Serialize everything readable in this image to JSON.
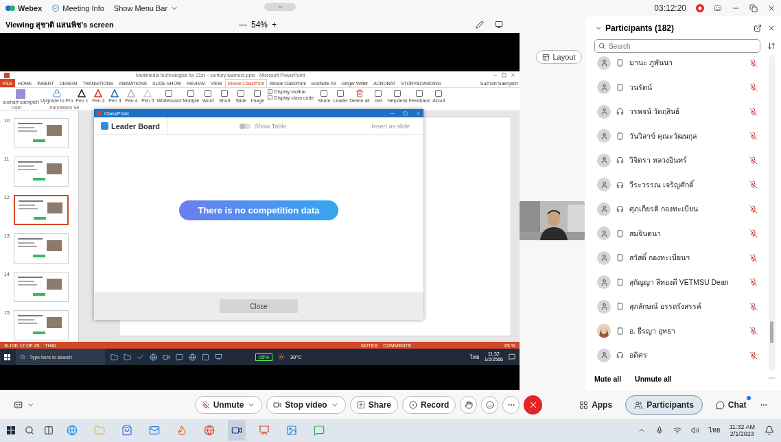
{
  "app_bar": {
    "brand": "Webex",
    "menus": [
      {
        "label": "Meeting Info",
        "kind": "info"
      },
      {
        "label": "Show Menu Bar",
        "kind": "dropdown"
      }
    ],
    "timer": "03:12:20"
  },
  "stage": {
    "viewing": "Viewing สุชาติ แสนพิช's screen",
    "zoom_minus": "—",
    "zoom": "54%",
    "zoom_plus": "+",
    "layout_button": "Layout"
  },
  "shared_screen": {
    "title": "Multimedia technologies for 21st ~ century learners.pptx - Microsoft PowerPoint",
    "user": "Suchart Saenpich",
    "tabs": [
      {
        "label": "FILE",
        "selected": false
      },
      {
        "label": "HOME",
        "selected": false
      },
      {
        "label": "INSERT",
        "selected": false
      },
      {
        "label": "DESIGN",
        "selected": false
      },
      {
        "label": "TRANSITIONS",
        "selected": false
      },
      {
        "label": "ANIMATIONS",
        "selected": false
      },
      {
        "label": "SLIDE SHOW",
        "selected": false
      },
      {
        "label": "REVIEW",
        "selected": false
      },
      {
        "label": "VIEW",
        "selected": false
      },
      {
        "label": "Inknoe ClassPoint",
        "selected": true
      },
      {
        "label": "Inknoe ClassPoint",
        "selected": false
      },
      {
        "label": "EndNote X9",
        "selected": false
      },
      {
        "label": "Ginger Writer",
        "selected": false
      },
      {
        "label": "ACROBAT",
        "selected": false
      },
      {
        "label": "STORYBOARDING",
        "selected": false
      }
    ],
    "ribbon": [
      {
        "label": "suchart saenpich",
        "kind": "avatar"
      },
      {
        "label": "Upgrade to Pro",
        "kind": "lock"
      },
      {
        "label": "Pen 1",
        "kind": "pen",
        "color": "#222222"
      },
      {
        "label": "Pen 2",
        "kind": "pen",
        "color": "#d03030"
      },
      {
        "label": "Pen 3",
        "kind": "pen",
        "color": "#2a5fb0"
      },
      {
        "label": "Pen 4",
        "kind": "pen",
        "color": "#b8b8b8"
      },
      {
        "label": "Pen 5",
        "kind": "pen",
        "color": "#cfcfcf"
      },
      {
        "label": "Whiteboard",
        "kind": "tool"
      },
      {
        "label": "Multiple",
        "kind": "tool"
      },
      {
        "label": "Word",
        "kind": "tool"
      },
      {
        "label": "Short",
        "kind": "tool"
      },
      {
        "label": "Slide",
        "kind": "tool"
      },
      {
        "label": "Image",
        "kind": "tool"
      },
      {
        "label": "Display toolbar",
        "kind": "check",
        "checked": true
      },
      {
        "label": "Display class code",
        "kind": "check",
        "checked": true
      },
      {
        "label": "Share",
        "kind": "tool"
      },
      {
        "label": "Leader",
        "kind": "tool"
      },
      {
        "label": "Delete all",
        "kind": "trash"
      },
      {
        "label": "Get",
        "kind": "tool"
      },
      {
        "label": "Helpdesk",
        "kind": "tool"
      },
      {
        "label": "Feedback",
        "kind": "tool"
      },
      {
        "label": "About",
        "kind": "tool"
      }
    ],
    "groups": [
      "User",
      "Annotation Se"
    ],
    "slides": [
      {
        "number": "10",
        "selected": false
      },
      {
        "number": "11",
        "selected": false
      },
      {
        "number": "12",
        "selected": true
      },
      {
        "number": "13",
        "selected": false
      },
      {
        "number": "14",
        "selected": false
      },
      {
        "number": "15",
        "selected": false
      }
    ],
    "dialog": {
      "title": "ClassPoint",
      "tab": "Leader Board",
      "toggle": {
        "label": "Show Table",
        "on": false
      },
      "insert": "Insert as slide",
      "message": "There is no competition data",
      "close": "Close"
    },
    "status_bar": {
      "slide": "SLIDE 12 OF 45",
      "language": "THAI",
      "notes": "NOTES",
      "comments": "COMMENTS",
      "zoom": "65 %"
    },
    "taskbar": {
      "search": "Type here to search",
      "battery": "95%",
      "weather": "30°C",
      "language": "ไทย",
      "time": "11:32",
      "date": "1/2/2566"
    }
  },
  "participants_panel": {
    "title": "Participants (182)",
    "search": {
      "placeholder": "Search"
    },
    "participants": [
      {
        "name": "มานะ ภูพันนา",
        "kind": "phone",
        "avatar": {
          "kind": "icon"
        }
      },
      {
        "name": "วนรัตน์",
        "kind": "phone",
        "avatar": {
          "kind": "icon"
        }
      },
      {
        "name": "วรพจน์ วัดฤสินธ์",
        "kind": "audio",
        "avatar": {
          "kind": "icon"
        }
      },
      {
        "name": "วันวิสาข์ คุณะวัฒนกุล",
        "kind": "phone",
        "avatar": {
          "kind": "icon"
        }
      },
      {
        "name": "วิจิตรา หลวงอินทร์",
        "kind": "audio",
        "avatar": {
          "kind": "icon"
        }
      },
      {
        "name": "วีระวรรณ เจริญศักดิ์",
        "kind": "audio",
        "avatar": {
          "kind": "icon"
        }
      },
      {
        "name": "ศุภเกียรติ กองทะเบียน",
        "kind": "audio",
        "avatar": {
          "kind": "icon"
        }
      },
      {
        "name": "สมจินตนา",
        "kind": "phone",
        "avatar": {
          "kind": "icon"
        }
      },
      {
        "name": "สวัสดิ์ กองทะเบียนฯ",
        "kind": "phone",
        "avatar": {
          "kind": "icon"
        }
      },
      {
        "name": "สุกัญญา ลีทองดี VETMSU Dean",
        "kind": "phone",
        "avatar": {
          "kind": "icon"
        }
      },
      {
        "name": "สุภลักษณ์ อรรถรังสรรค์",
        "kind": "phone",
        "avatar": {
          "kind": "icon"
        }
      },
      {
        "name": "อ. ธีรญา อุทธา",
        "kind": "phone"
      },
      {
        "name": "อดิศร",
        "kind": "audio",
        "avatar": {
          "kind": "icon"
        }
      }
    ],
    "mute_all": "Mute all",
    "unmute_all": "Unmute all"
  },
  "controls": [
    {
      "label": "Unmute",
      "kind": "mic"
    },
    {
      "label": "Stop video",
      "kind": "video"
    },
    {
      "label": "Share",
      "kind": "share"
    },
    {
      "label": "Record",
      "kind": "record"
    }
  ],
  "side_tabs": [
    {
      "label": "Apps",
      "kind": "apps",
      "selected": false
    },
    {
      "label": "Participants",
      "kind": "people",
      "selected": true
    },
    {
      "label": "Chat",
      "kind": "chat",
      "selected": false
    }
  ],
  "windows_taskbar": {
    "language": "ไทย",
    "time": "11:32 AM",
    "date": "2/1/2023"
  }
}
